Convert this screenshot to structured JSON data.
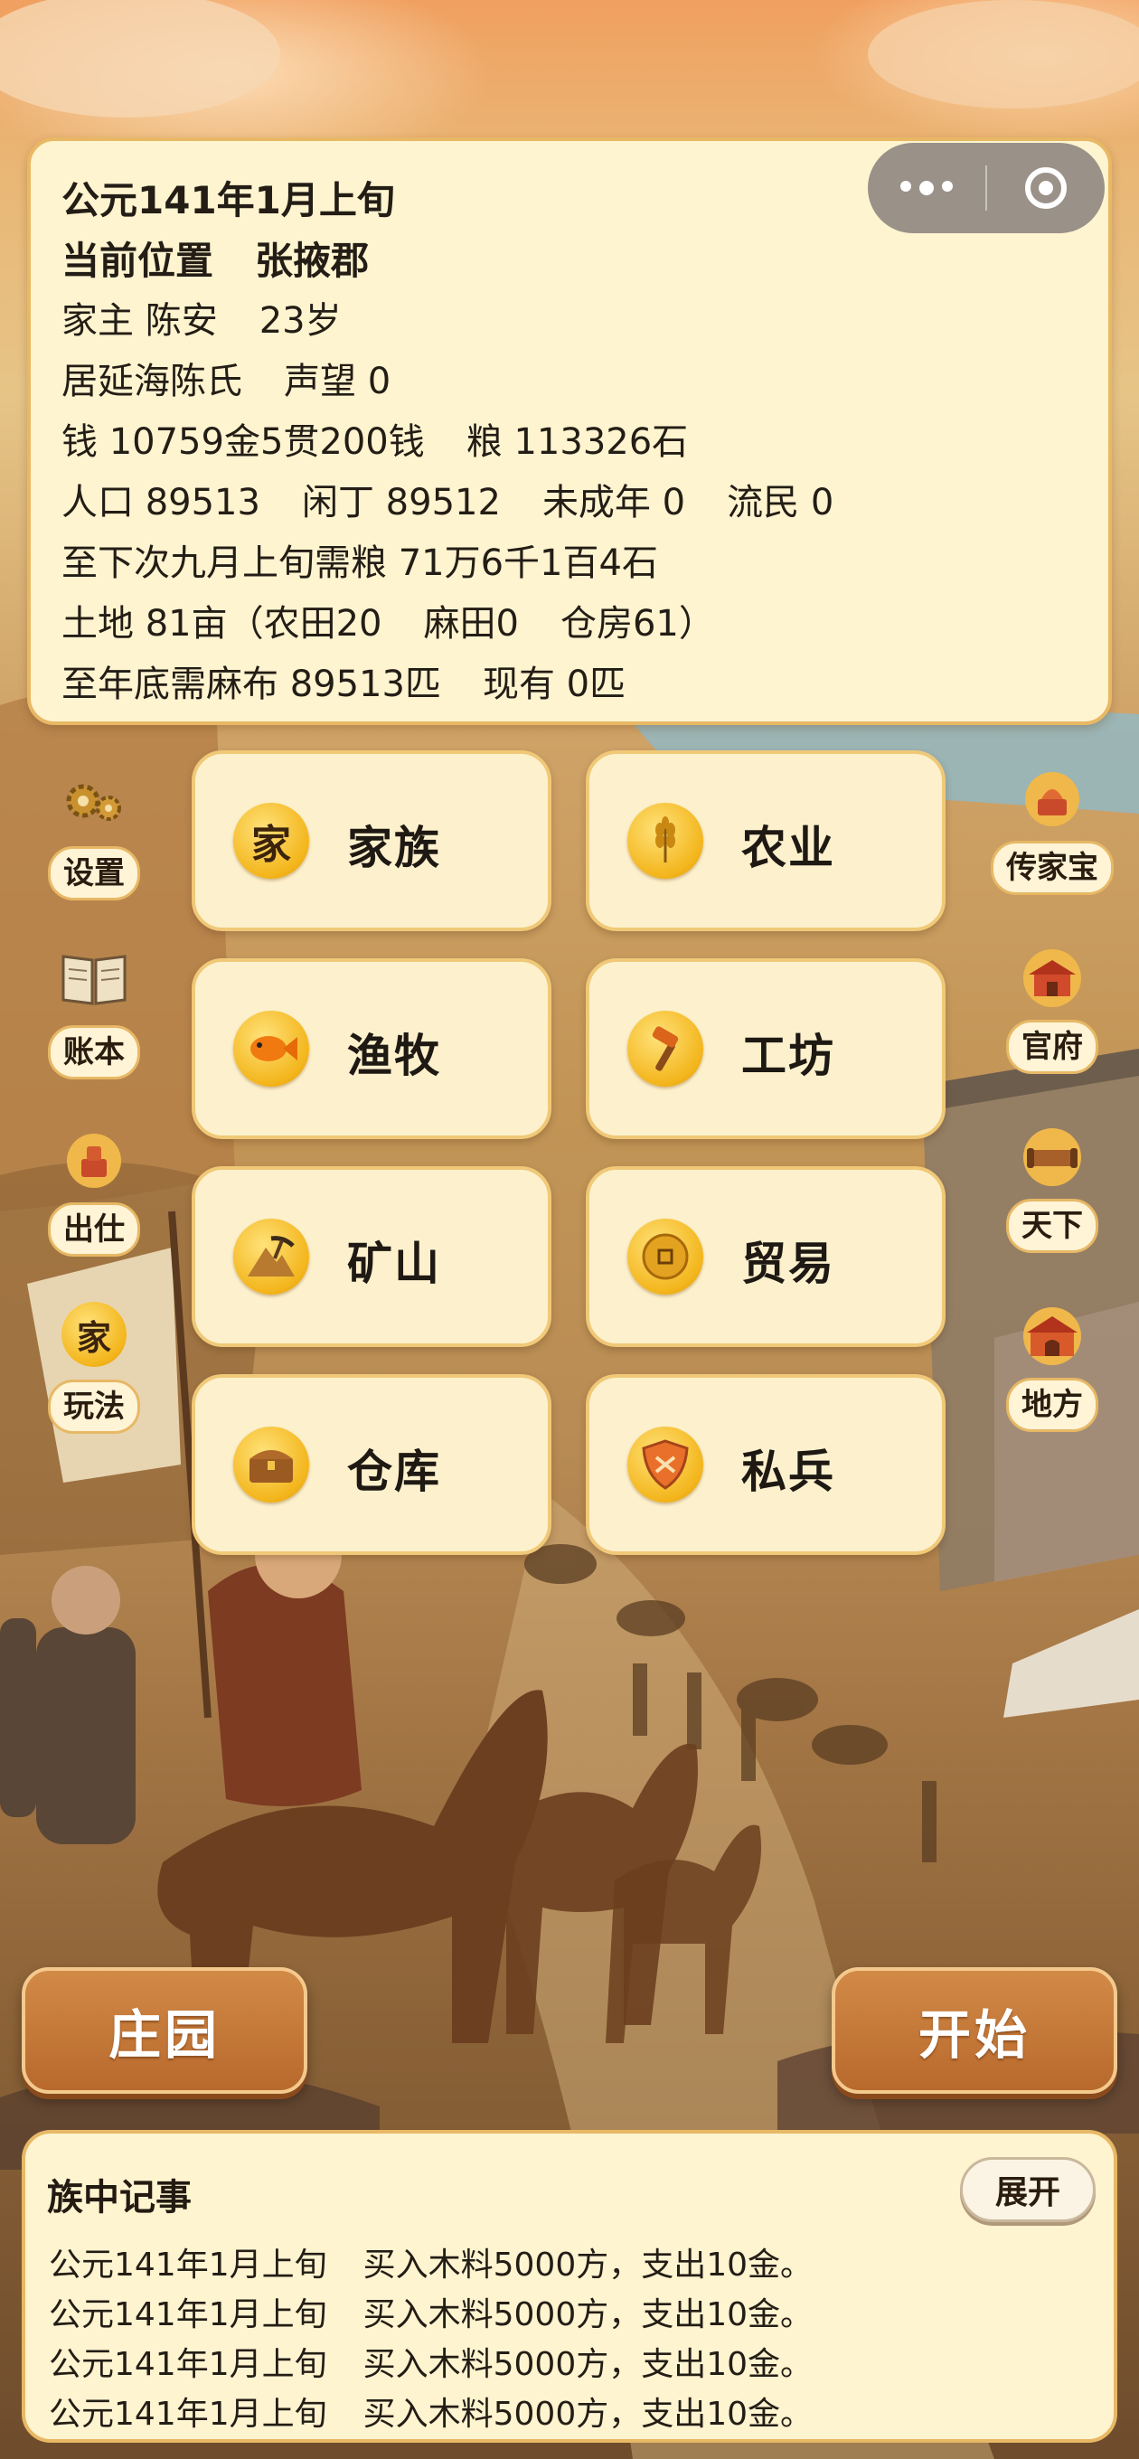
{
  "info": {
    "date": "公元141年1月上旬",
    "location_label": "当前位置",
    "location_value": "张掖郡",
    "head_label": "家主",
    "head_name": "陈安",
    "head_age": "23岁",
    "clan_name": "居延海陈氏",
    "prestige": "声望 0",
    "money": "钱 10759金5贯200钱",
    "grain": "粮 113326石",
    "population": "人口 89513",
    "idle": "闲丁 89512",
    "minors": "未成年 0",
    "refugees": "流民 0",
    "grain_need": "至下次九月上旬需粮 71万6千1百4石",
    "land": "土地 81亩（农田20",
    "hemp_field": "麻田0",
    "warehouse": "仓房61）",
    "cloth_need": "至年底需麻布 89513匹",
    "cloth_have": "现有 0匹"
  },
  "grid": [
    {
      "label": "家族",
      "icon": "家",
      "icon_name": "family-icon"
    },
    {
      "label": "农业",
      "icon": "",
      "icon_name": "wheat-icon"
    },
    {
      "label": "渔牧",
      "icon": "",
      "icon_name": "fish-icon"
    },
    {
      "label": "工坊",
      "icon": "",
      "icon_name": "hammer-icon"
    },
    {
      "label": "矿山",
      "icon": "",
      "icon_name": "mountain-pickaxe-icon"
    },
    {
      "label": "贸易",
      "icon": "",
      "icon_name": "coin-icon"
    },
    {
      "label": "仓库",
      "icon": "",
      "icon_name": "chest-icon"
    },
    {
      "label": "私兵",
      "icon": "",
      "icon_name": "shield-icon"
    }
  ],
  "left_menu": [
    {
      "label": "设置",
      "icon_name": "gears-icon"
    },
    {
      "label": "账本",
      "icon_name": "ledger-book-icon"
    },
    {
      "label": "出仕",
      "icon_name": "official-seal-icon"
    },
    {
      "label": "玩法",
      "icon_name": "family-badge-icon",
      "icon_char": "家"
    }
  ],
  "right_menu": [
    {
      "label": "传家宝",
      "icon_name": "heirloom-icon"
    },
    {
      "label": "官府",
      "icon_name": "government-hall-icon"
    },
    {
      "label": "天下",
      "icon_name": "scroll-icon"
    },
    {
      "label": "地方",
      "icon_name": "city-gate-icon"
    }
  ],
  "buttons": {
    "estate": "庄园",
    "start": "开始"
  },
  "log": {
    "title": "族中记事",
    "expand": "展开",
    "entries": [
      {
        "date": "公元141年1月上旬",
        "text": "买入木料5000方，支出10金。"
      },
      {
        "date": "公元141年1月上旬",
        "text": "买入木料5000方，支出10金。"
      },
      {
        "date": "公元141年1月上旬",
        "text": "买入木料5000方，支出10金。"
      },
      {
        "date": "公元141年1月上旬",
        "text": "买入木料5000方，支出10金。"
      }
    ]
  },
  "colors": {
    "panel": "#fff4d0",
    "panel_border": "#e8b865",
    "accent_button": "#c47a3a",
    "icon_gold": "#f3b51b"
  }
}
